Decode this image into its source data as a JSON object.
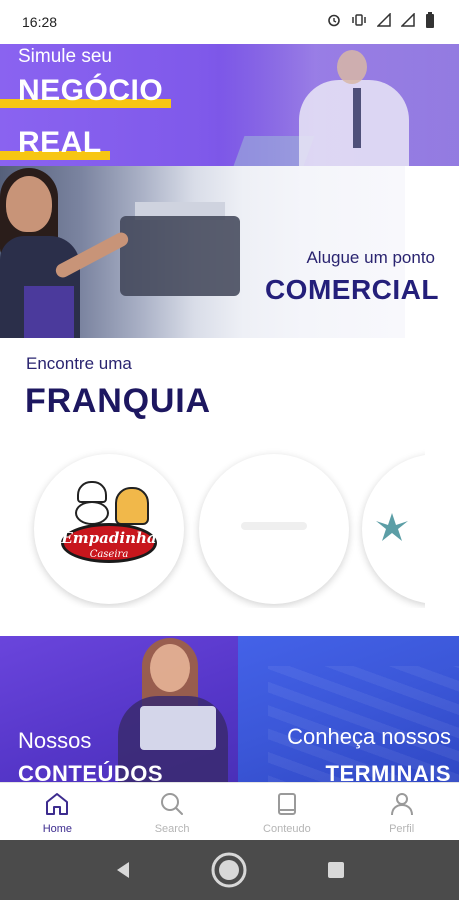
{
  "status_bar": {
    "time": "16:28",
    "icons": [
      "alarm-icon",
      "vibrate-icon",
      "signal-icon",
      "signal-icon",
      "battery-icon"
    ]
  },
  "banners": {
    "simule": {
      "small": "Simule seu",
      "line1": "NEGÓCIO",
      "line2": "REAL",
      "highlight_color": "#f7c613"
    },
    "comercial": {
      "small": "Alugue um ponto",
      "big": "COMERCIAL"
    }
  },
  "franquia": {
    "small": "Encontre uma",
    "title": "FRANQUIA",
    "logos": [
      {
        "word1": "Empadinha",
        "word2": "Caseira"
      },
      {
        "word1": "",
        "word2": ""
      },
      {
        "word1": "",
        "word2": ""
      }
    ]
  },
  "promos": {
    "conteudos": {
      "small": "Nossos",
      "big": "CONTEÚDOS"
    },
    "terminais": {
      "small": "Conheça nossos",
      "big": "TERMINAIS"
    }
  },
  "bottom_nav": {
    "items": [
      {
        "label": "Home",
        "icon": "home-icon",
        "active": true
      },
      {
        "label": "Search",
        "icon": "search-icon",
        "active": false
      },
      {
        "label": "Conteudo",
        "icon": "book-icon",
        "active": false
      },
      {
        "label": "Perfil",
        "icon": "user-icon",
        "active": false
      }
    ],
    "active_color": "#3d2c8f",
    "inactive_color": "#b5b5b5"
  },
  "system_nav": {
    "buttons": [
      "back-icon",
      "home-circle-icon",
      "recents-icon"
    ]
  },
  "colors": {
    "primary_purple": "#7f59ea",
    "dark_indigo": "#1d1760",
    "accent_yellow": "#f7c613"
  }
}
